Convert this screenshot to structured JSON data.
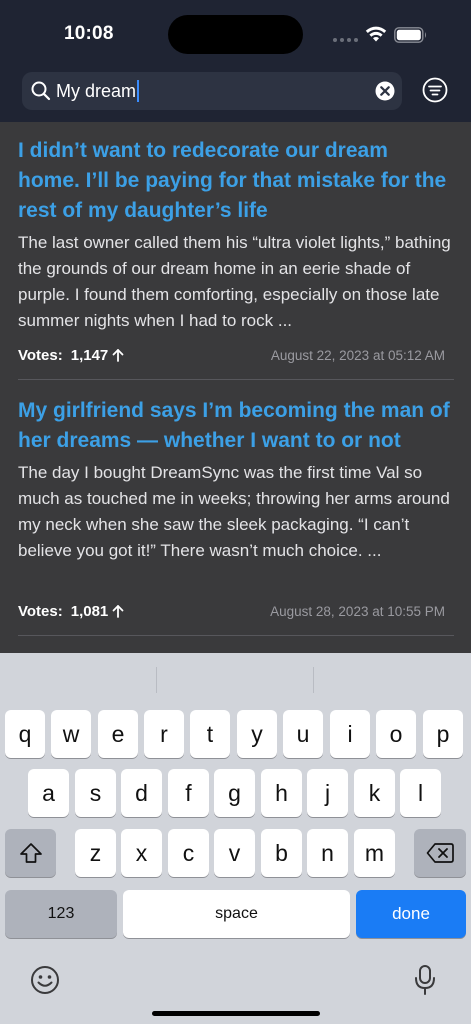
{
  "status": {
    "time": "10:08"
  },
  "search": {
    "query": "My dream"
  },
  "stories": [
    {
      "title": "I didn’t want to redecorate our dream home. I’ll be paying for that mistake for the rest of my daughter’s life",
      "excerpt": "The last owner called them his “ultra violet lights,” bathing the grounds of our dream home in an eerie shade of purple. I found them comforting, especially on those late summer nights when I had to rock ...",
      "votes_label": "Votes:",
      "votes": "1,147",
      "date": "August 22, 2023 at 05:12 AM"
    },
    {
      "title": "My girlfriend says I’m becoming the man of her dreams — whether I want to or not",
      "excerpt": "The day I bought DreamSync was the first time Val so much as touched me in weeks; throwing her arms around my neck when she saw the sleek packaging. “I can’t believe you got it!”  There wasn’t much choice. ...",
      "votes_label": "Votes:",
      "votes": "1,081",
      "date": "August 28, 2023 at 10:55 PM"
    }
  ],
  "keyboard": {
    "row1": [
      "q",
      "w",
      "e",
      "r",
      "t",
      "y",
      "u",
      "i",
      "o",
      "p"
    ],
    "row2": [
      "a",
      "s",
      "d",
      "f",
      "g",
      "h",
      "j",
      "k",
      "l"
    ],
    "row3": [
      "z",
      "x",
      "c",
      "v",
      "b",
      "n",
      "m"
    ],
    "numbers_label": "123",
    "space_label": "space",
    "done_label": "done"
  },
  "icons": {
    "search": "search-icon",
    "clear": "clear-icon",
    "filter": "filter-icon",
    "upvote": "arrow-up-icon",
    "shift": "shift-icon",
    "delete": "backspace-icon",
    "emoji": "emoji-icon",
    "mic": "microphone-icon"
  },
  "colors": {
    "header_bg": "#1f2433",
    "list_bg": "#3a3a3c",
    "title_blue": "#3ca0e6",
    "done_blue": "#1a7cf5"
  }
}
